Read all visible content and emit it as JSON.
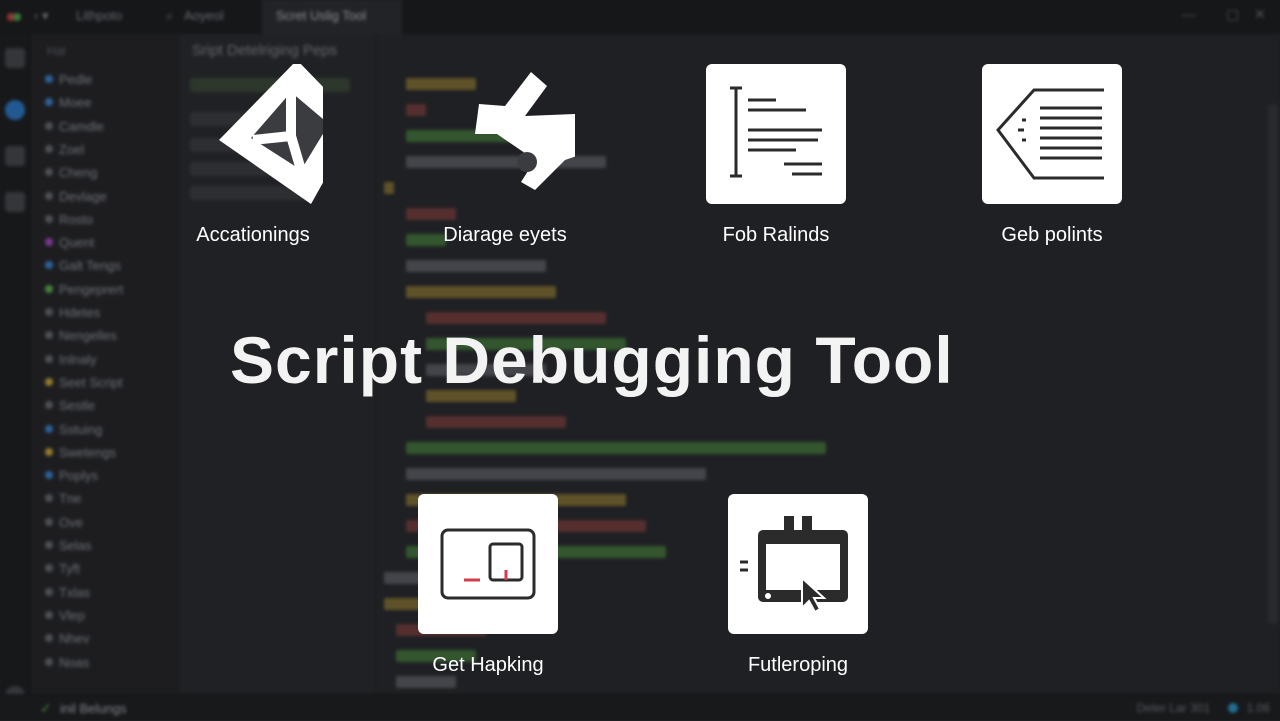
{
  "window": {
    "title_left": "Lithpoto",
    "tab_inactive": "Aoyeol",
    "tab_active": "Scret Uslig Tool",
    "breadcrumb": "Sript Detelriging Peps"
  },
  "sidebar": {
    "header": "Hat",
    "items": [
      {
        "label": "Pedle",
        "color": "#3b8be0"
      },
      {
        "label": "Moee",
        "color": "#3b8be0"
      },
      {
        "label": "Camdle",
        "color": "#6b7077"
      },
      {
        "label": "Zoel",
        "color": "#6b7077"
      },
      {
        "label": "Cheng",
        "color": "#6b7077"
      },
      {
        "label": "Devlage",
        "color": "#6b7077"
      },
      {
        "label": "Rosto",
        "color": "#6b7077"
      },
      {
        "label": "Quent",
        "color": "#b04bd0"
      },
      {
        "label": "Galt Tengs",
        "color": "#3b8be0"
      },
      {
        "label": "Pengeprert",
        "color": "#5fbf4c"
      },
      {
        "label": "Hdetes",
        "color": "#6b7077"
      },
      {
        "label": "Nengelles",
        "color": "#6b7077"
      },
      {
        "label": "Inlnaly",
        "color": "#6b7077"
      },
      {
        "label": "Seet Script",
        "color": "#d9b23c"
      },
      {
        "label": "Sestle",
        "color": "#6b7077"
      },
      {
        "label": "Sstuing",
        "color": "#3b8be0"
      },
      {
        "label": "Swetengs",
        "color": "#d9b23c"
      },
      {
        "label": "Poplys",
        "color": "#3b8be0"
      },
      {
        "label": "Tne",
        "color": "#6b7077"
      },
      {
        "label": "Ove",
        "color": "#6b7077"
      },
      {
        "label": "Selas",
        "color": "#6b7077"
      },
      {
        "label": "Tyft",
        "color": "#6b7077"
      },
      {
        "label": "Txlas",
        "color": "#6b7077"
      },
      {
        "label": "Vlep",
        "color": "#6b7077"
      },
      {
        "label": "Nhev",
        "color": "#6b7077"
      },
      {
        "label": "Noas",
        "color": "#6b7077"
      }
    ]
  },
  "features_top": [
    {
      "label": "Accationings",
      "icon": "unity-cube-icon"
    },
    {
      "label": "Diarage eyets",
      "icon": "puzzle-icon"
    },
    {
      "label": "Fob Ralinds",
      "icon": "document-lines-icon"
    },
    {
      "label": "Geb polints",
      "icon": "tag-list-icon"
    }
  ],
  "features_bottom": [
    {
      "label": "Get Hapking",
      "icon": "window-panel-icon"
    },
    {
      "label": "Futleroping",
      "icon": "monitor-cursor-icon"
    }
  ],
  "main_title": "Script Debugging Tool",
  "statusbar": {
    "left": "inil Belungs",
    "right": "Deter Lar 301",
    "version": "1.06"
  },
  "colors": {
    "background": "#1f2023",
    "tile": "#ffffff",
    "icon": "#2b2b2b",
    "accent_red": "#d93a4a"
  }
}
